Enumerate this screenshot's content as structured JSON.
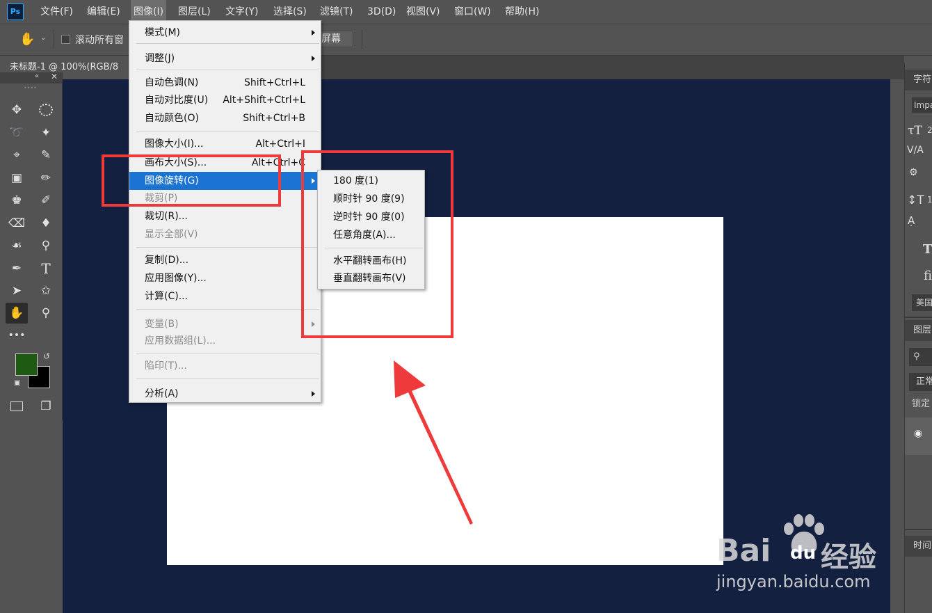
{
  "app": {
    "logo": "Ps"
  },
  "menubar": [
    "文件(F)",
    "编辑(E)",
    "图像(I)",
    "图层(L)",
    "文字(Y)",
    "选择(S)",
    "滤镜(T)",
    "3D(D)",
    "视图(V)",
    "窗口(W)",
    "帮助(H)"
  ],
  "options": {
    "scroll_all": "滚动所有窗",
    "fill_screen": "屏幕"
  },
  "document": {
    "tab_title": "未标题-1 @ 100%(RGB/8"
  },
  "image_menu": {
    "items": [
      {
        "label": "模式(M)",
        "shortcut": "",
        "submenu": true,
        "disabled": false
      },
      {
        "label": "调整(J)",
        "shortcut": "",
        "submenu": true,
        "disabled": false
      },
      {
        "label": "自动色调(N)",
        "shortcut": "Shift+Ctrl+L",
        "submenu": false,
        "disabled": false
      },
      {
        "label": "自动对比度(U)",
        "shortcut": "Alt+Shift+Ctrl+L",
        "submenu": false,
        "disabled": false
      },
      {
        "label": "自动颜色(O)",
        "shortcut": "Shift+Ctrl+B",
        "submenu": false,
        "disabled": false
      },
      {
        "label": "图像大小(I)...",
        "shortcut": "Alt+Ctrl+I",
        "submenu": false,
        "disabled": false
      },
      {
        "label": "画布大小(S)...",
        "shortcut": "Alt+Ctrl+C",
        "submenu": false,
        "disabled": false
      },
      {
        "label": "图像旋转(G)",
        "shortcut": "",
        "submenu": true,
        "disabled": false,
        "highlighted": true
      },
      {
        "label": "裁剪(P)",
        "shortcut": "",
        "submenu": false,
        "disabled": true
      },
      {
        "label": "裁切(R)...",
        "shortcut": "",
        "submenu": false,
        "disabled": false
      },
      {
        "label": "显示全部(V)",
        "shortcut": "",
        "submenu": false,
        "disabled": true
      },
      {
        "label": "复制(D)...",
        "shortcut": "",
        "submenu": false,
        "disabled": false
      },
      {
        "label": "应用图像(Y)...",
        "shortcut": "",
        "submenu": false,
        "disabled": false
      },
      {
        "label": "计算(C)...",
        "shortcut": "",
        "submenu": false,
        "disabled": false
      },
      {
        "label": "变量(B)",
        "shortcut": "",
        "submenu": true,
        "disabled": true
      },
      {
        "label": "应用数据组(L)...",
        "shortcut": "",
        "submenu": false,
        "disabled": true
      },
      {
        "label": "陷印(T)...",
        "shortcut": "",
        "submenu": false,
        "disabled": true
      },
      {
        "label": "分析(A)",
        "shortcut": "",
        "submenu": true,
        "disabled": false
      }
    ]
  },
  "rotate_submenu": {
    "items": [
      "180 度(1)",
      "顺时针 90 度(9)",
      "逆时针 90 度(0)",
      "任意角度(A)...",
      "水平翻转画布(H)",
      "垂直翻转画布(V)"
    ]
  },
  "right_panel": {
    "character_tab": "字符",
    "font": "Impa",
    "size": "2",
    "leading": "1",
    "language": "美国",
    "layers_tab": "图层",
    "blend_mode": "正常",
    "lock_label": "锁定",
    "timeline_tab": "时间"
  },
  "colors": {
    "foreground": "#1e5a12",
    "background": "#000000",
    "canvas_bg": "#13203f",
    "highlight": "#1c74d2",
    "annotation": "#ee3a3a"
  },
  "watermark": {
    "brand": "Bai",
    "brand2": "du",
    "cn": "经验",
    "url": "jingyan.baidu.com"
  }
}
